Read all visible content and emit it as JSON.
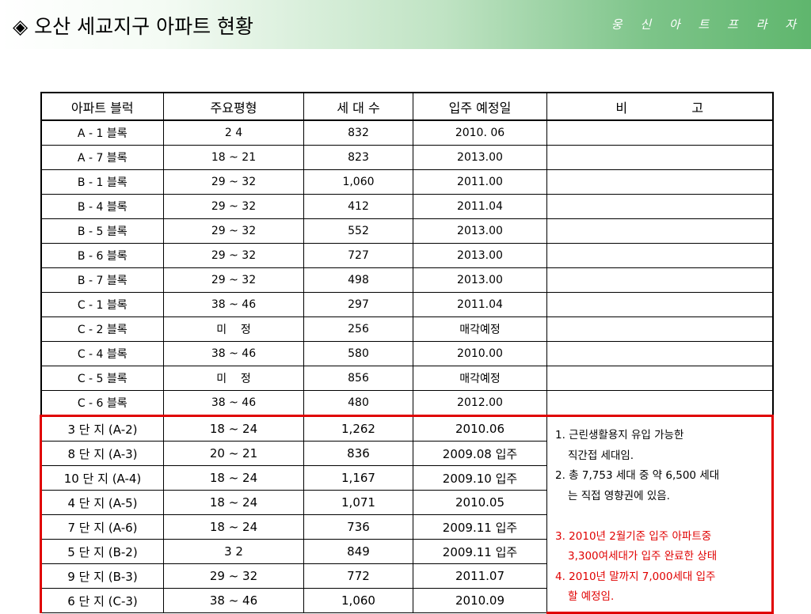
{
  "header": {
    "title": "◈ 오산 세교지구 아파트 현황",
    "company": "웅 신 아 트 프 라 자"
  },
  "table": {
    "headers": [
      "아파트 블럭",
      "주요평형",
      "세 대 수",
      "입주 예정일",
      "비                고"
    ],
    "block_rows": [
      {
        "block": "A - 1 블록",
        "size": "2 4",
        "units": "832",
        "date": "2010. 06"
      },
      {
        "block": "A - 7 블록",
        "size": "18 ~ 21",
        "units": "823",
        "date": "2013.00"
      },
      {
        "block": "B - 1 블록",
        "size": "29 ~ 32",
        "units": "1,060",
        "date": "2011.00"
      },
      {
        "block": "B - 4 블록",
        "size": "29 ~ 32",
        "units": "412",
        "date": "2011.04"
      },
      {
        "block": "B - 5 블록",
        "size": "29 ~ 32",
        "units": "552",
        "date": "2013.00"
      },
      {
        "block": "B - 6 블록",
        "size": "29 ~ 32",
        "units": "727",
        "date": "2013.00"
      },
      {
        "block": "B - 7 블록",
        "size": "29 ~ 32",
        "units": "498",
        "date": "2013.00"
      },
      {
        "block": "C - 1 블록",
        "size": "38 ~ 46",
        "units": "297",
        "date": "2011.04"
      },
      {
        "block": "C - 2 블록",
        "size": "미    정",
        "units": "256",
        "date": "매각예정"
      },
      {
        "block": "C - 4 블록",
        "size": "38 ~ 46",
        "units": "580",
        "date": "2010.00"
      },
      {
        "block": "C - 5 블록",
        "size": "미    정",
        "units": "856",
        "date": "매각예정"
      },
      {
        "block": "C - 6 블록",
        "size": "38 ~ 46",
        "units": "480",
        "date": "2012.00"
      }
    ],
    "danji_rows": [
      {
        "block": "3 단 지 (A-2)",
        "size": "18 ~ 24",
        "units": "1,262",
        "date": "2010.06"
      },
      {
        "block": "8 단 지 (A-3)",
        "size": "20 ~ 21",
        "units": "836",
        "date": "2009.08 입주"
      },
      {
        "block": "10 단 지 (A-4)",
        "size": "18 ~ 24",
        "units": "1,167",
        "date": "2009.10 입주"
      },
      {
        "block": "4 단 지 (A-5)",
        "size": "18 ~ 24",
        "units": "1,071",
        "date": "2010.05"
      },
      {
        "block": "7 단 지 (A-6)",
        "size": "18 ~ 24",
        "units": "736",
        "date": "2009.11 입주"
      },
      {
        "block": "5 단 지 (B-2)",
        "size": "3 2",
        "units": "849",
        "date": "2009.11 입주"
      },
      {
        "block": "9 단 지 (B-3)",
        "size": "29 ~ 32",
        "units": "772",
        "date": "2011.07"
      },
      {
        "block": "6 단 지 (C-3)",
        "size": "38 ~ 46",
        "units": "1,060",
        "date": "2010.09"
      }
    ],
    "notes": {
      "l1": "1. 근린생활용지 유입 가능한",
      "l2": "직간접 세대임.",
      "l3": "2. 총 7,753 세대 중 약 6,500 세대",
      "l4": "는 직접 영향권에 있음.",
      "l5": "3. 2010년 2월기준 입주 아파트중",
      "l6": "3,300여세대가 입주 완료한 상태",
      "l7": "4. 2010년 말까지 7,000세대 입주",
      "l8": "할 예정임."
    },
    "colors": {
      "highlight_border": "#e00000",
      "moved_in_text": "#1f2fb8",
      "note_red_text": "#e00000",
      "header_gradient_end": "#5fb66d"
    }
  }
}
